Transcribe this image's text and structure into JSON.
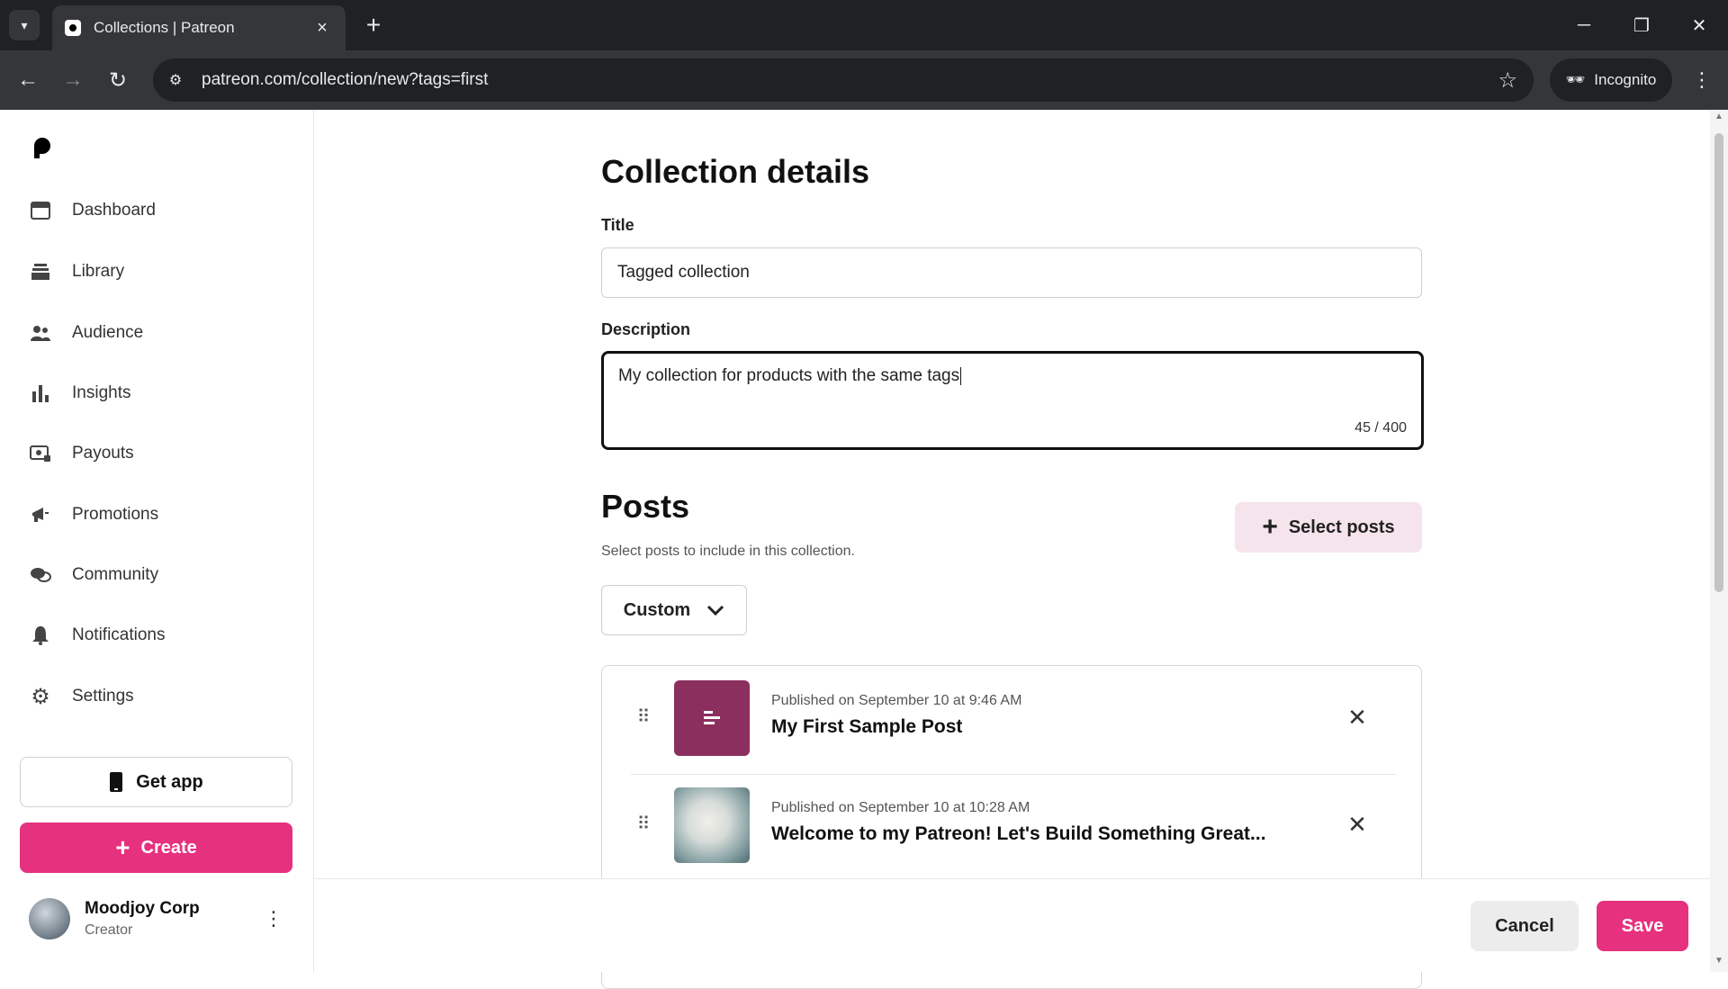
{
  "browser": {
    "tab_title": "Collections | Patreon",
    "url": "patreon.com/collection/new?tags=first",
    "incognito_label": "Incognito"
  },
  "sidebar": {
    "items": [
      {
        "label": "Dashboard",
        "icon": "dashboard-icon"
      },
      {
        "label": "Library",
        "icon": "library-icon"
      },
      {
        "label": "Audience",
        "icon": "audience-icon"
      },
      {
        "label": "Insights",
        "icon": "insights-icon"
      },
      {
        "label": "Payouts",
        "icon": "payouts-icon"
      },
      {
        "label": "Promotions",
        "icon": "promotions-icon"
      },
      {
        "label": "Community",
        "icon": "community-icon"
      },
      {
        "label": "Notifications",
        "icon": "notifications-icon"
      },
      {
        "label": "Settings",
        "icon": "settings-icon"
      }
    ],
    "get_app_label": "Get app",
    "create_label": "Create",
    "user": {
      "name": "Moodjoy Corp",
      "role": "Creator"
    }
  },
  "form": {
    "heading": "Collection details",
    "title_label": "Title",
    "title_value": "Tagged collection",
    "description_label": "Description",
    "description_value": "My collection for products with the same tags",
    "description_counter": "45 / 400"
  },
  "posts": {
    "heading": "Posts",
    "helper": "Select posts to include in this collection.",
    "select_label": "Select posts",
    "sort_value": "Custom",
    "items": [
      {
        "meta": "Published on September 10 at 9:46 AM",
        "title": "My First Sample Post",
        "thumb": "text-post-icon"
      },
      {
        "meta": "Published on September 10 at 10:28 AM",
        "title": "Welcome to my Patreon! Let's Build Something Great...",
        "thumb": "image"
      }
    ]
  },
  "footer": {
    "cancel_label": "Cancel",
    "save_label": "Save"
  },
  "colors": {
    "brand_pink": "#e6317f",
    "select_bg": "#f6e4ec",
    "text_post_thumb": "#8b2f5f"
  }
}
